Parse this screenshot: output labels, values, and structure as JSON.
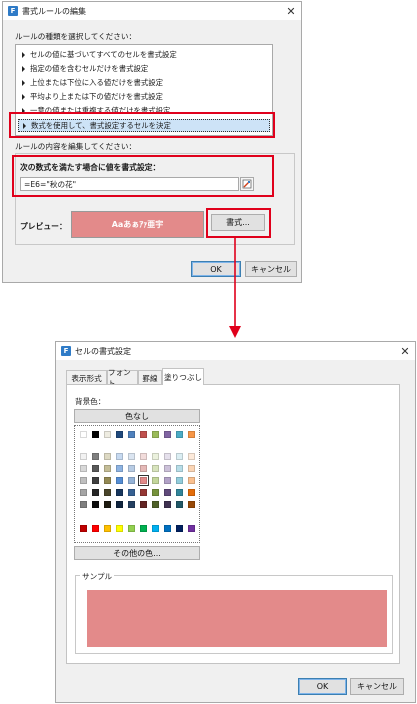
{
  "dialog1": {
    "title": "書式ルールの編集",
    "rule_type_label": "ルールの種類を選択してください：",
    "rule_types": [
      "セルの値に基づいてすべてのセルを書式設定",
      "指定の値を含むセルだけを書式設定",
      "上位または下位に入る値だけを書式設定",
      "平均より上または下の値だけを書式設定",
      "一意の値または重複する値だけを書式設定",
      "数式を使用して、書式設定するセルを決定"
    ],
    "selected_rule_index": 5,
    "edit_label": "ルールの内容を編集してください：",
    "formula_label": "次の数式を満たす場合に値を書式設定：",
    "formula_value": "=E6=\"秋の花\"",
    "preview_label": "プレビュー：",
    "preview_text": "Aaあぁｱｧ亜宇",
    "preview_color": "#e38a8a",
    "format_button": "書式...",
    "ok": "OK",
    "cancel": "キャンセル"
  },
  "dialog2": {
    "title": "セルの書式設定",
    "tabs": [
      "表示形式",
      "フォント",
      "罫線",
      "塗りつぶし"
    ],
    "active_tab": 3,
    "bg_color_label": "背景色：",
    "no_color_button": "色なし",
    "more_colors_button": "その他の色...",
    "sample_label": "サンプル",
    "sample_color": "#e38a8a",
    "selected_swatch_color": "#e38a8a",
    "ok": "OK",
    "cancel": "キャンセル"
  },
  "palette": {
    "row1": [
      "#ffffff",
      "#000000",
      "#eeece1",
      "#1f497d",
      "#4f81bd",
      "#c0504d",
      "#9bbb59",
      "#8064a2",
      "#4bacc6",
      "#f79646"
    ],
    "theme_rows": [
      [
        "#f2f2f2",
        "#7f7f7f",
        "#ddd9c3",
        "#c6d9f0",
        "#dbe5f1",
        "#f2dcdb",
        "#ebf1dd",
        "#e5e0ec",
        "#dbeef3",
        "#fdeada"
      ],
      [
        "#d8d8d8",
        "#595959",
        "#c4bd97",
        "#8db3e2",
        "#b8cce4",
        "#e5b9b7",
        "#d7e3bc",
        "#ccc1d9",
        "#b7dde8",
        "#fbd5b5"
      ],
      [
        "#bfbfbf",
        "#3f3f3f",
        "#938953",
        "#548dd4",
        "#95b3d7",
        "#e38a8a",
        "#c3d69b",
        "#b2a2c7",
        "#92cddc",
        "#fac08f"
      ],
      [
        "#a5a5a5",
        "#262626",
        "#494429",
        "#17365d",
        "#366092",
        "#953734",
        "#76923c",
        "#5f497a",
        "#31859b",
        "#e36c09"
      ],
      [
        "#7f7f7f",
        "#0c0c0c",
        "#1d1b10",
        "#0f243e",
        "#244061",
        "#632423",
        "#4f6128",
        "#3f3151",
        "#205867",
        "#974806"
      ]
    ],
    "standard": [
      "#c00000",
      "#ff0000",
      "#ffc000",
      "#ffff00",
      "#92d050",
      "#00b050",
      "#00b0f0",
      "#0070c0",
      "#002060",
      "#7030a0"
    ]
  }
}
